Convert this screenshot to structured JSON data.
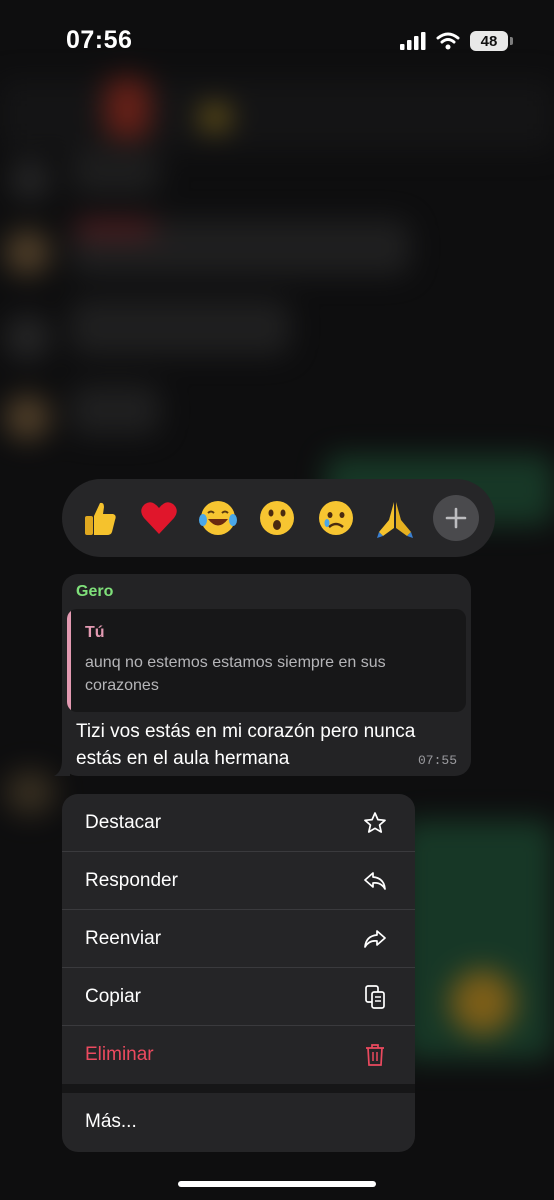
{
  "status_bar": {
    "time": "07:56",
    "battery": "48"
  },
  "reactions": {
    "emojis": [
      {
        "name": "thumbs-up",
        "glyph": "👍"
      },
      {
        "name": "red-heart",
        "glyph": "❤️"
      },
      {
        "name": "tears-of-joy",
        "glyph": "😂"
      },
      {
        "name": "surprised",
        "glyph": "😮"
      },
      {
        "name": "crying",
        "glyph": "😢"
      },
      {
        "name": "folded-hands",
        "glyph": "🙏"
      }
    ],
    "more_icon": "plus-icon"
  },
  "message": {
    "sender": "Gero",
    "quote_author": "Tú",
    "quote_text": "aunq no estemos estamos siempre en sus corazones",
    "text": "Tizi vos estás en mi corazón pero nunca estás en el aula hermana",
    "time": "07:55"
  },
  "menu": {
    "destacar": {
      "label": "Destacar",
      "icon": "star-icon"
    },
    "responder": {
      "label": "Responder",
      "icon": "reply-icon"
    },
    "reenviar": {
      "label": "Reenviar",
      "icon": "forward-icon"
    },
    "copiar": {
      "label": "Copiar",
      "icon": "copy-icon"
    },
    "eliminar": {
      "label": "Eliminar",
      "icon": "trash-icon"
    },
    "mas": {
      "label": "Más..."
    }
  },
  "colors": {
    "sender_name": "#7fe07a",
    "quote_accent": "#e39ab2",
    "danger": "#ec4a5f"
  }
}
